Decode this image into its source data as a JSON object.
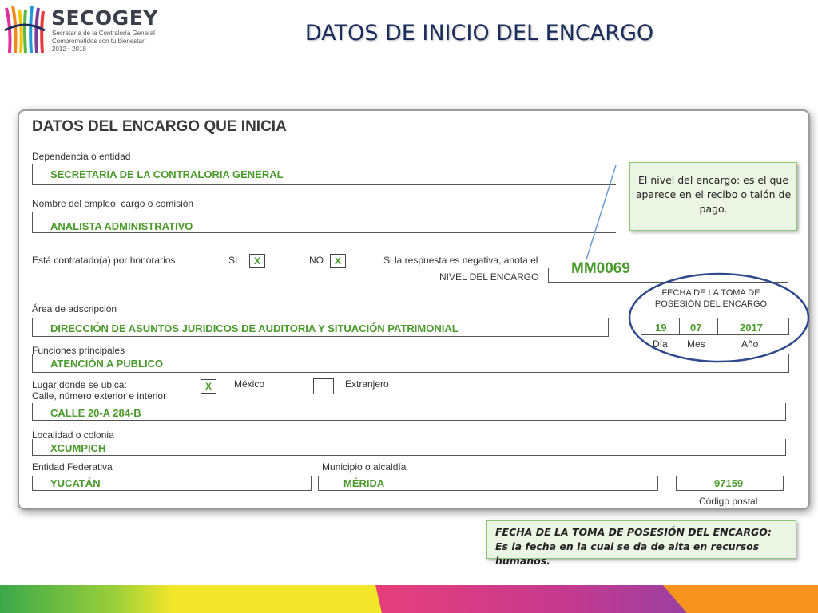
{
  "logo": {
    "name": "SECOGEY",
    "line1": "Secretaría de la Contraloría General",
    "line2": "Comprometidos con tu bienestar",
    "line3": "2012 • 2018"
  },
  "slide_title": "DATOS DE INICIO DEL ENCARGO",
  "form": {
    "heading": "DATOS DEL ENCARGO QUE INICIA",
    "dependencia": {
      "label": "Dependencia o entidad",
      "value": "SECRETARIA DE LA CONTRALORIA GENERAL"
    },
    "empleo": {
      "label": "Nombre del empleo, cargo o comisión",
      "value": "ANALISTA ADMINISTRATIVO"
    },
    "honorarios": {
      "label": "Está contratado(a) por honorarios",
      "si_label": "SI",
      "si_mark": "X",
      "no_label": "NO",
      "no_mark": "X",
      "note": "Si la respuesta es negativa, anota el",
      "nivel_label": "NIVEL DEL ENCARGO",
      "nivel_value": "MM0069"
    },
    "fecha_toma": {
      "header_line1": "FECHA DE LA TOMA DE",
      "header_line2": "POSESIÓN DEL ENCARGO",
      "dia": "19",
      "mes": "07",
      "anio": "2017",
      "dia_label": "Día",
      "mes_label": "Mes",
      "anio_label": "Año"
    },
    "area": {
      "label": "Área de adscripción",
      "value": "DIRECCIÓN DE ASUNTOS JURIDICOS DE AUDITORIA Y SITUACIÓN PATRIMONIAL"
    },
    "funciones": {
      "label": "Funciones principales",
      "value": "ATENCIÓN A PUBLICO"
    },
    "lugar": {
      "label_line1": "Lugar donde se ubica:",
      "label_line2": "Calle, número exterior e interior",
      "mexico_mark": "X",
      "mexico_label": "México",
      "extranjero_label": "Extranjero",
      "calle_value": "CALLE  20-A  284-B"
    },
    "localidad": {
      "label": "Localidad o colonia",
      "value": "XCUMPICH"
    },
    "entidad": {
      "label": "Entidad Federativa",
      "value": "YUCATÁN"
    },
    "municipio": {
      "label": "Municipio o alcaldía",
      "value": "MÉRIDA"
    },
    "codigo_postal": {
      "label": "Código postal",
      "value": "97159"
    }
  },
  "callout_nivel": "El nivel del encargo: es el que aparece en el recibo o talón de pago.",
  "callout_fecha": {
    "line1": "FECHA DE LA TOMA DE POSESIÓN DEL ENCARGO:",
    "line2": "Es la fecha en la cual se da de alta en recursos humanos."
  },
  "colors": {
    "title": "#1c2c5b",
    "value_text": "#4a9a2c",
    "callout_fill": "#eaf6e3",
    "ellipse": "#2e4a8c"
  }
}
